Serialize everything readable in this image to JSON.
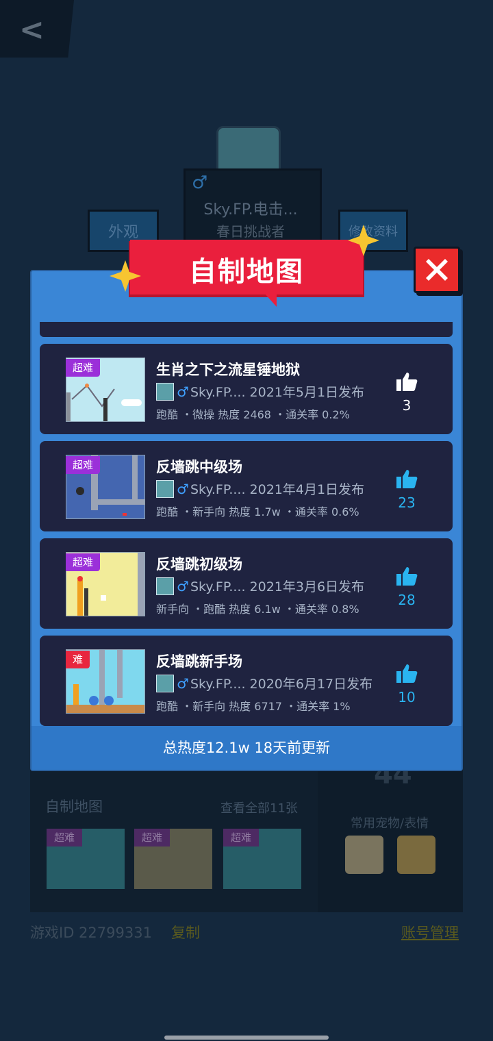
{
  "background": {
    "back_icon": "chevron-left-icon",
    "player": {
      "gender": "♂",
      "name": "Sky.FP.电击...",
      "title": "春日挑战者"
    },
    "appearance_button": "外观",
    "edit_profile_button": "修改资料",
    "maps_section": {
      "title": "自制地图",
      "view_all": "查看全部11张",
      "thumbs": [
        {
          "tag": "超难"
        },
        {
          "tag": "超难"
        },
        {
          "tag": "超难"
        }
      ]
    },
    "stat_number": "44",
    "pets_label": "常用宠物/表情",
    "game_id": "游戏ID 22799331",
    "copy_link": "复制",
    "account_link": "账号管理"
  },
  "dialog": {
    "title": "自制地图",
    "close_icon": "close-icon",
    "maps": [
      {
        "title": "生肖之下之流星锤地狱",
        "tag": "超难",
        "tag_color": "#9b30d9",
        "gender": "♂",
        "author_date": "Sky.FP.... 2021年5月1日发布",
        "meta": "跑酷 ・微操 热度 2468 ・通关率 0.2%",
        "likes": "3",
        "like_color": "#ffffff",
        "thumb_bg": "#bfe8f2"
      },
      {
        "title": "反墙跳中级场",
        "tag": "超难",
        "tag_color": "#9b30d9",
        "gender": "♂",
        "author_date": "Sky.FP.... 2021年4月1日发布",
        "meta": "跑酷 ・新手向 热度 1.7w ・通关率 0.6%",
        "likes": "23",
        "like_color": "#2ab4f0",
        "thumb_bg": "#4466b0"
      },
      {
        "title": "反墙跳初级场",
        "tag": "超难",
        "tag_color": "#9b30d9",
        "gender": "♂",
        "author_date": "Sky.FP.... 2021年3月6日发布",
        "meta": "新手向 ・跑酷 热度 6.1w ・通关率 0.8%",
        "likes": "28",
        "like_color": "#2ab4f0",
        "thumb_bg": "#f2ec9a"
      },
      {
        "title": "反墙跳新手场",
        "tag": "难",
        "tag_color": "#e8263f",
        "gender": "♂",
        "author_date": "Sky.FP.... 2020年6月17日发布",
        "meta": "跑酷 ・新手向 热度 6717 ・通关率 1%",
        "likes": "10",
        "like_color": "#2ab4f0",
        "thumb_bg": "#7fd8ee"
      }
    ],
    "footer": "总热度12.1w 18天前更新"
  }
}
